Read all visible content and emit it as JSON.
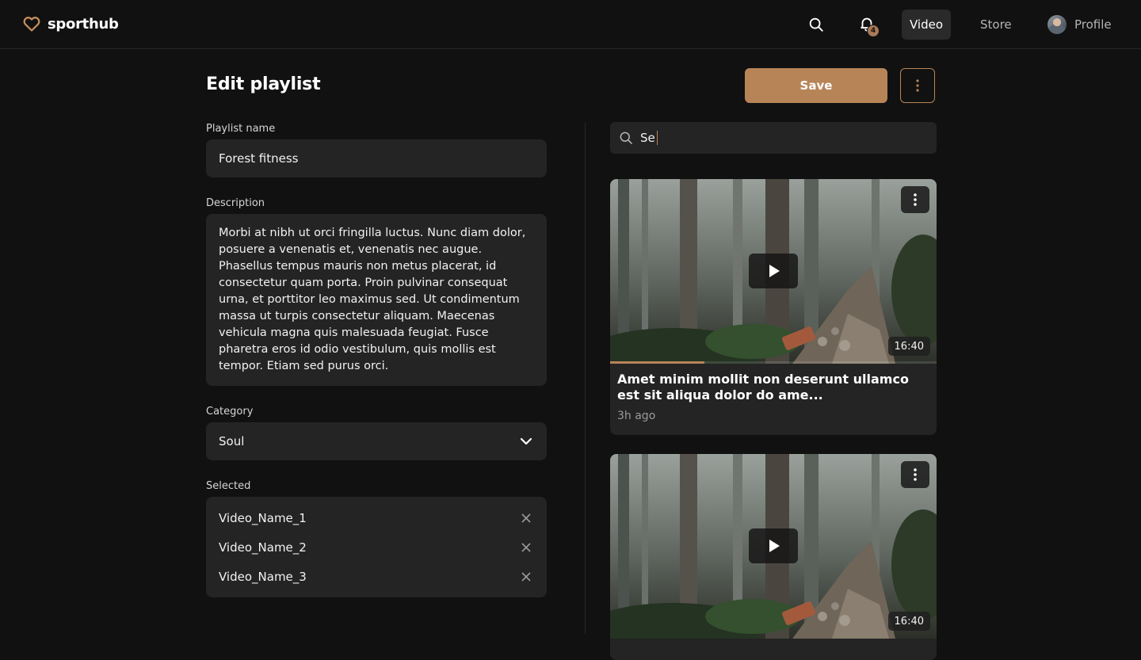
{
  "brand": {
    "name": "sporthub",
    "accent": "#b78458"
  },
  "nav": {
    "notifications_count": "4",
    "links": {
      "video": "Video",
      "store": "Store",
      "profile": "Profile"
    },
    "active": "Video"
  },
  "page": {
    "title": "Edit playlist",
    "save_label": "Save"
  },
  "form": {
    "name_label": "Playlist name",
    "name_value": "Forest fitness",
    "description_label": "Description",
    "description_value": "Morbi at nibh ut orci fringilla luctus. Nunc diam dolor, posuere a venenatis et, venenatis nec augue. Phasellus tempus mauris non metus placerat, id consectetur quam porta. Proin pulvinar consequat urna, et porttitor leo maximus sed. Ut condimentum massa ut turpis consectetur aliquam. Maecenas vehicula magna quis malesuada feugiat. Fusce pharetra eros id odio vestibulum, quis mollis est tempor. Etiam sed purus orci.",
    "category_label": "Category",
    "category_value": "Soul",
    "selected_label": "Selected",
    "selected": [
      {
        "name": "Video_Name_1"
      },
      {
        "name": "Video_Name_2"
      },
      {
        "name": "Video_Name_3"
      }
    ]
  },
  "search": {
    "value": "Se"
  },
  "videos": [
    {
      "title": "Amet minim mollit non deserunt ullamco est sit aliqua dolor do ame...",
      "meta": "3h ago",
      "duration": "16:40",
      "progress": 0.29
    },
    {
      "duration": "16:40"
    }
  ]
}
